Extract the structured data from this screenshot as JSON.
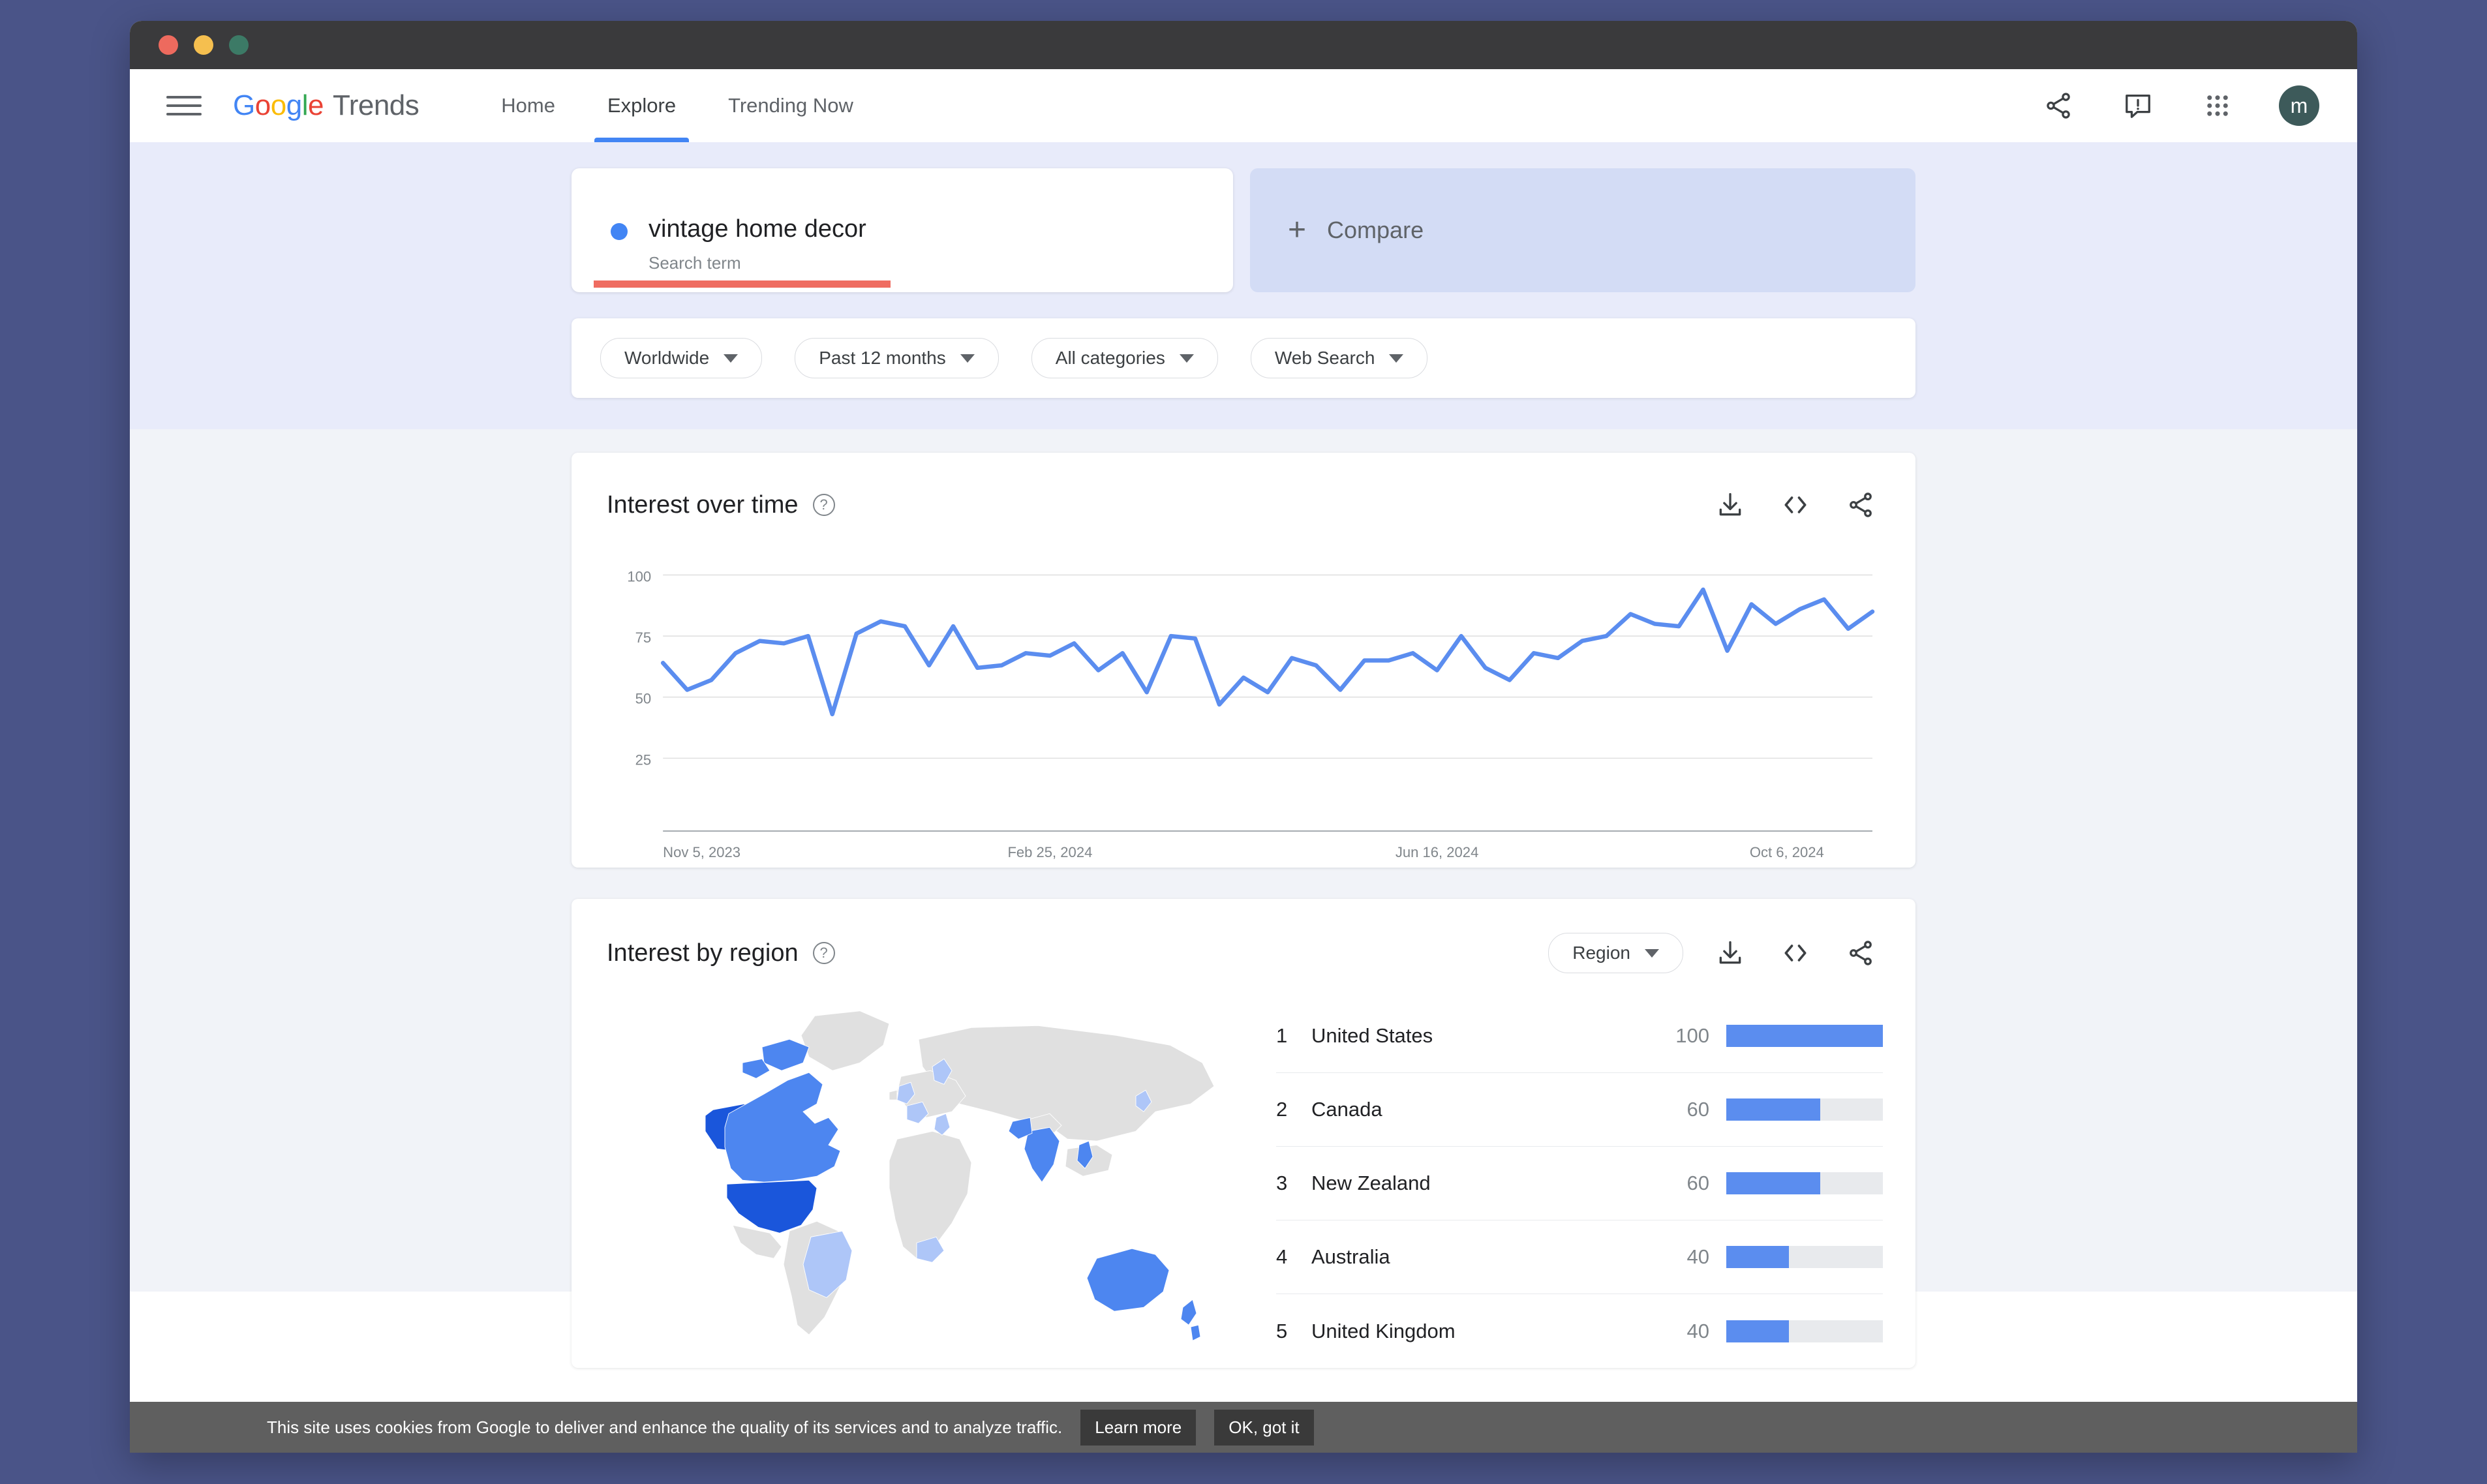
{
  "window": {
    "traffic_lights": [
      "close",
      "minimize",
      "maximize"
    ]
  },
  "header": {
    "menu_icon": "hamburger-menu-icon",
    "brand": {
      "g1": "G",
      "g2": "o",
      "g3": "o",
      "g4": "g",
      "g5": "l",
      "g6": "e",
      "product": "Trends"
    },
    "nav": [
      {
        "label": "Home",
        "active": false
      },
      {
        "label": "Explore",
        "active": true
      },
      {
        "label": "Trending Now",
        "active": false
      }
    ],
    "actions": [
      "share-icon",
      "feedback-icon",
      "apps-grid-icon"
    ],
    "avatar_initial": "m"
  },
  "query": {
    "term": {
      "name": "vintage home decor",
      "type": "Search term"
    },
    "compare_label": "Compare",
    "filters": [
      {
        "label": "Worldwide"
      },
      {
        "label": "Past 12 months"
      },
      {
        "label": "All categories"
      },
      {
        "label": "Web Search"
      }
    ]
  },
  "interest_over_time": {
    "title": "Interest over time",
    "help": "?",
    "actions": [
      "download-icon",
      "embed-code-icon",
      "share-icon"
    ]
  },
  "interest_by_region": {
    "title": "Interest by region",
    "help": "?",
    "selector_label": "Region",
    "actions": [
      "download-icon",
      "embed-code-icon",
      "share-icon"
    ],
    "rows": [
      {
        "rank": "1",
        "name": "United States",
        "value": "100",
        "pct": 100
      },
      {
        "rank": "2",
        "name": "Canada",
        "value": "60",
        "pct": 60
      },
      {
        "rank": "3",
        "name": "New Zealand",
        "value": "60",
        "pct": 60
      },
      {
        "rank": "4",
        "name": "Australia",
        "value": "40",
        "pct": 40
      },
      {
        "rank": "5",
        "name": "United Kingdom",
        "value": "40",
        "pct": 40
      }
    ]
  },
  "cookie_banner": {
    "text": "This site uses cookies from Google to deliver and enhance the quality of its services and to analyze traffic.",
    "learn_more": "Learn more",
    "ok": "OK, got it"
  },
  "colors": {
    "accent_blue": "#4285f4",
    "line_blue": "#5b8def",
    "underline_red": "#ef6c61",
    "band_bg": "#e8ebfa",
    "compare_bg": "#d3dcf5",
    "page_bg": "#f1f3f8",
    "map_dark": "#1a56db",
    "map_mid": "#4d86f0",
    "map_light": "#aec6f8",
    "map_none": "#e0e0e0"
  },
  "chart_data": {
    "type": "line",
    "title": "Interest over time",
    "xlabel": "",
    "ylabel": "",
    "ylim": [
      0,
      110
    ],
    "yticks": [
      25,
      50,
      75,
      100
    ],
    "grid": true,
    "legend": false,
    "xtick_labels": [
      "Nov 5, 2023",
      "Feb 25, 2024",
      "Jun 16, 2024",
      "Oct 6, 2024"
    ],
    "xtick_positions": [
      0,
      16,
      32,
      48
    ],
    "series": [
      {
        "name": "vintage home decor",
        "color": "#5b8def",
        "values": [
          64,
          53,
          57,
          68,
          73,
          72,
          75,
          43,
          76,
          81,
          79,
          63,
          79,
          62,
          63,
          68,
          67,
          72,
          61,
          68,
          52,
          75,
          74,
          47,
          58,
          52,
          66,
          63,
          53,
          65,
          65,
          68,
          61,
          75,
          62,
          57,
          68,
          66,
          73,
          75,
          84,
          80,
          79,
          94,
          69,
          88,
          80,
          86,
          90,
          78,
          85
        ]
      }
    ]
  }
}
